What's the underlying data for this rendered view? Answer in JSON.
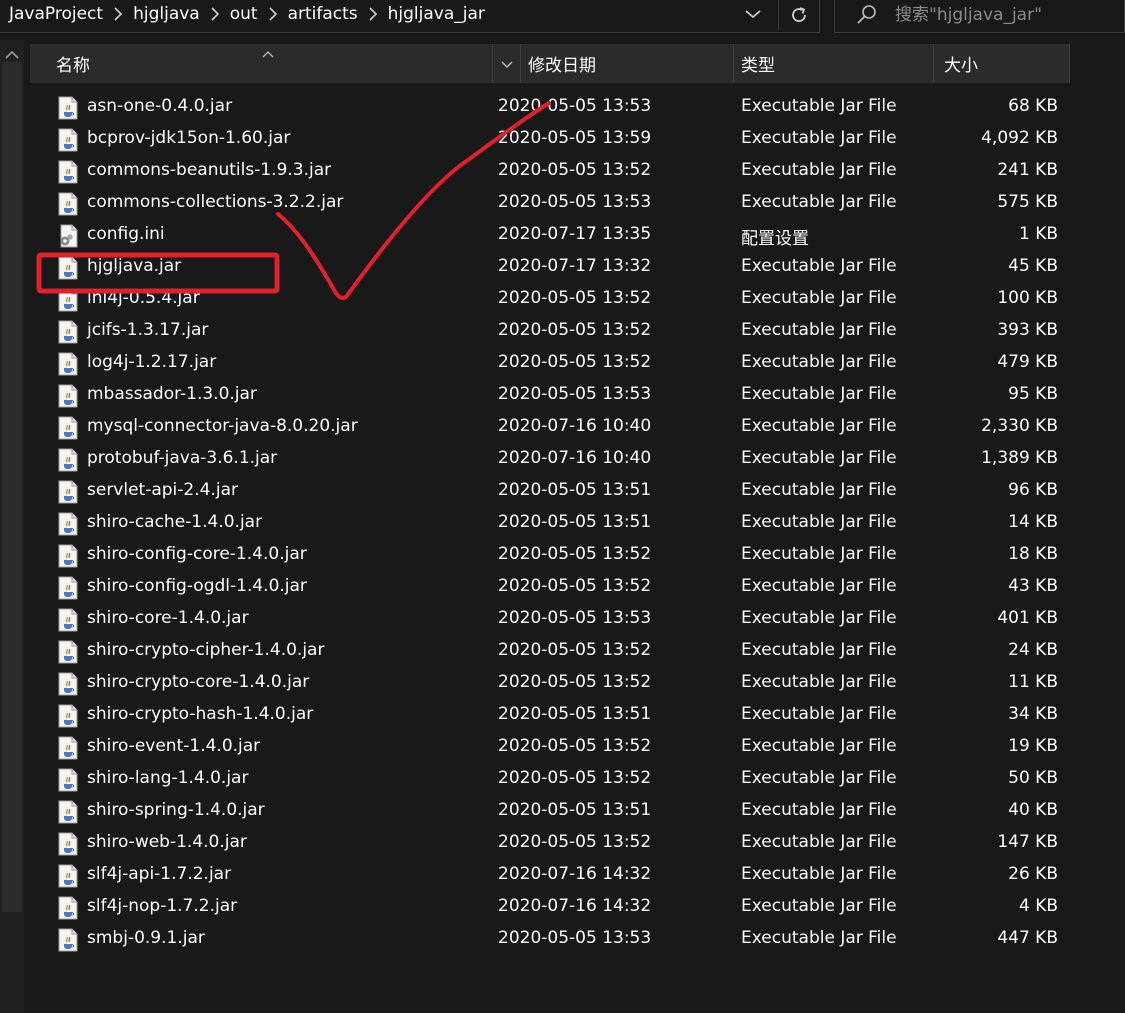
{
  "breadcrumb": [
    "JavaProject",
    "hjgljava",
    "out",
    "artifacts",
    "hjgljava_jar"
  ],
  "search": {
    "placeholder": "搜索\"hjgljava_jar\""
  },
  "columns": {
    "name": "名称",
    "date": "修改日期",
    "type": "类型",
    "size": "大小"
  },
  "files": [
    {
      "name": "asn-one-0.4.0.jar",
      "date": "2020-05-05 13:53",
      "type": "Executable Jar File",
      "size": "68 KB",
      "icon": "jar-file-icon"
    },
    {
      "name": "bcprov-jdk15on-1.60.jar",
      "date": "2020-05-05 13:59",
      "type": "Executable Jar File",
      "size": "4,092 KB",
      "icon": "jar-file-icon"
    },
    {
      "name": "commons-beanutils-1.9.3.jar",
      "date": "2020-05-05 13:52",
      "type": "Executable Jar File",
      "size": "241 KB",
      "icon": "jar-file-icon"
    },
    {
      "name": "commons-collections-3.2.2.jar",
      "date": "2020-05-05 13:53",
      "type": "Executable Jar File",
      "size": "575 KB",
      "icon": "jar-file-icon"
    },
    {
      "name": "config.ini",
      "date": "2020-07-17 13:35",
      "type": "配置设置",
      "size": "1 KB",
      "icon": "settings-file-icon"
    },
    {
      "name": "hjgljava.jar",
      "date": "2020-07-17 13:32",
      "type": "Executable Jar File",
      "size": "45 KB",
      "icon": "jar-file-icon"
    },
    {
      "name": "ini4j-0.5.4.jar",
      "date": "2020-05-05 13:52",
      "type": "Executable Jar File",
      "size": "100 KB",
      "icon": "jar-file-icon"
    },
    {
      "name": "jcifs-1.3.17.jar",
      "date": "2020-05-05 13:52",
      "type": "Executable Jar File",
      "size": "393 KB",
      "icon": "jar-file-icon"
    },
    {
      "name": "log4j-1.2.17.jar",
      "date": "2020-05-05 13:52",
      "type": "Executable Jar File",
      "size": "479 KB",
      "icon": "jar-file-icon"
    },
    {
      "name": "mbassador-1.3.0.jar",
      "date": "2020-05-05 13:53",
      "type": "Executable Jar File",
      "size": "95 KB",
      "icon": "jar-file-icon"
    },
    {
      "name": "mysql-connector-java-8.0.20.jar",
      "date": "2020-07-16 10:40",
      "type": "Executable Jar File",
      "size": "2,330 KB",
      "icon": "jar-file-icon"
    },
    {
      "name": "protobuf-java-3.6.1.jar",
      "date": "2020-07-16 10:40",
      "type": "Executable Jar File",
      "size": "1,389 KB",
      "icon": "jar-file-icon"
    },
    {
      "name": "servlet-api-2.4.jar",
      "date": "2020-05-05 13:51",
      "type": "Executable Jar File",
      "size": "96 KB",
      "icon": "jar-file-icon"
    },
    {
      "name": "shiro-cache-1.4.0.jar",
      "date": "2020-05-05 13:51",
      "type": "Executable Jar File",
      "size": "14 KB",
      "icon": "jar-file-icon"
    },
    {
      "name": "shiro-config-core-1.4.0.jar",
      "date": "2020-05-05 13:52",
      "type": "Executable Jar File",
      "size": "18 KB",
      "icon": "jar-file-icon"
    },
    {
      "name": "shiro-config-ogdl-1.4.0.jar",
      "date": "2020-05-05 13:52",
      "type": "Executable Jar File",
      "size": "43 KB",
      "icon": "jar-file-icon"
    },
    {
      "name": "shiro-core-1.4.0.jar",
      "date": "2020-05-05 13:53",
      "type": "Executable Jar File",
      "size": "401 KB",
      "icon": "jar-file-icon"
    },
    {
      "name": "shiro-crypto-cipher-1.4.0.jar",
      "date": "2020-05-05 13:52",
      "type": "Executable Jar File",
      "size": "24 KB",
      "icon": "jar-file-icon"
    },
    {
      "name": "shiro-crypto-core-1.4.0.jar",
      "date": "2020-05-05 13:52",
      "type": "Executable Jar File",
      "size": "11 KB",
      "icon": "jar-file-icon"
    },
    {
      "name": "shiro-crypto-hash-1.4.0.jar",
      "date": "2020-05-05 13:51",
      "type": "Executable Jar File",
      "size": "34 KB",
      "icon": "jar-file-icon"
    },
    {
      "name": "shiro-event-1.4.0.jar",
      "date": "2020-05-05 13:52",
      "type": "Executable Jar File",
      "size": "19 KB",
      "icon": "jar-file-icon"
    },
    {
      "name": "shiro-lang-1.4.0.jar",
      "date": "2020-05-05 13:52",
      "type": "Executable Jar File",
      "size": "50 KB",
      "icon": "jar-file-icon"
    },
    {
      "name": "shiro-spring-1.4.0.jar",
      "date": "2020-05-05 13:51",
      "type": "Executable Jar File",
      "size": "40 KB",
      "icon": "jar-file-icon"
    },
    {
      "name": "shiro-web-1.4.0.jar",
      "date": "2020-05-05 13:52",
      "type": "Executable Jar File",
      "size": "147 KB",
      "icon": "jar-file-icon"
    },
    {
      "name": "slf4j-api-1.7.2.jar",
      "date": "2020-07-16 14:32",
      "type": "Executable Jar File",
      "size": "26 KB",
      "icon": "jar-file-icon"
    },
    {
      "name": "slf4j-nop-1.7.2.jar",
      "date": "2020-07-16 14:32",
      "type": "Executable Jar File",
      "size": "4 KB",
      "icon": "jar-file-icon"
    },
    {
      "name": "smbj-0.9.1.jar",
      "date": "2020-05-05 13:53",
      "type": "Executable Jar File",
      "size": "447 KB",
      "icon": "jar-file-icon"
    }
  ],
  "annotation": {
    "color": "#e0202a",
    "highlighted_file": "hjgljava.jar"
  },
  "colors": {
    "background": "#191919",
    "header": "#2b2b2b",
    "text": "#ffffff",
    "muted": "#8a8a8a"
  }
}
